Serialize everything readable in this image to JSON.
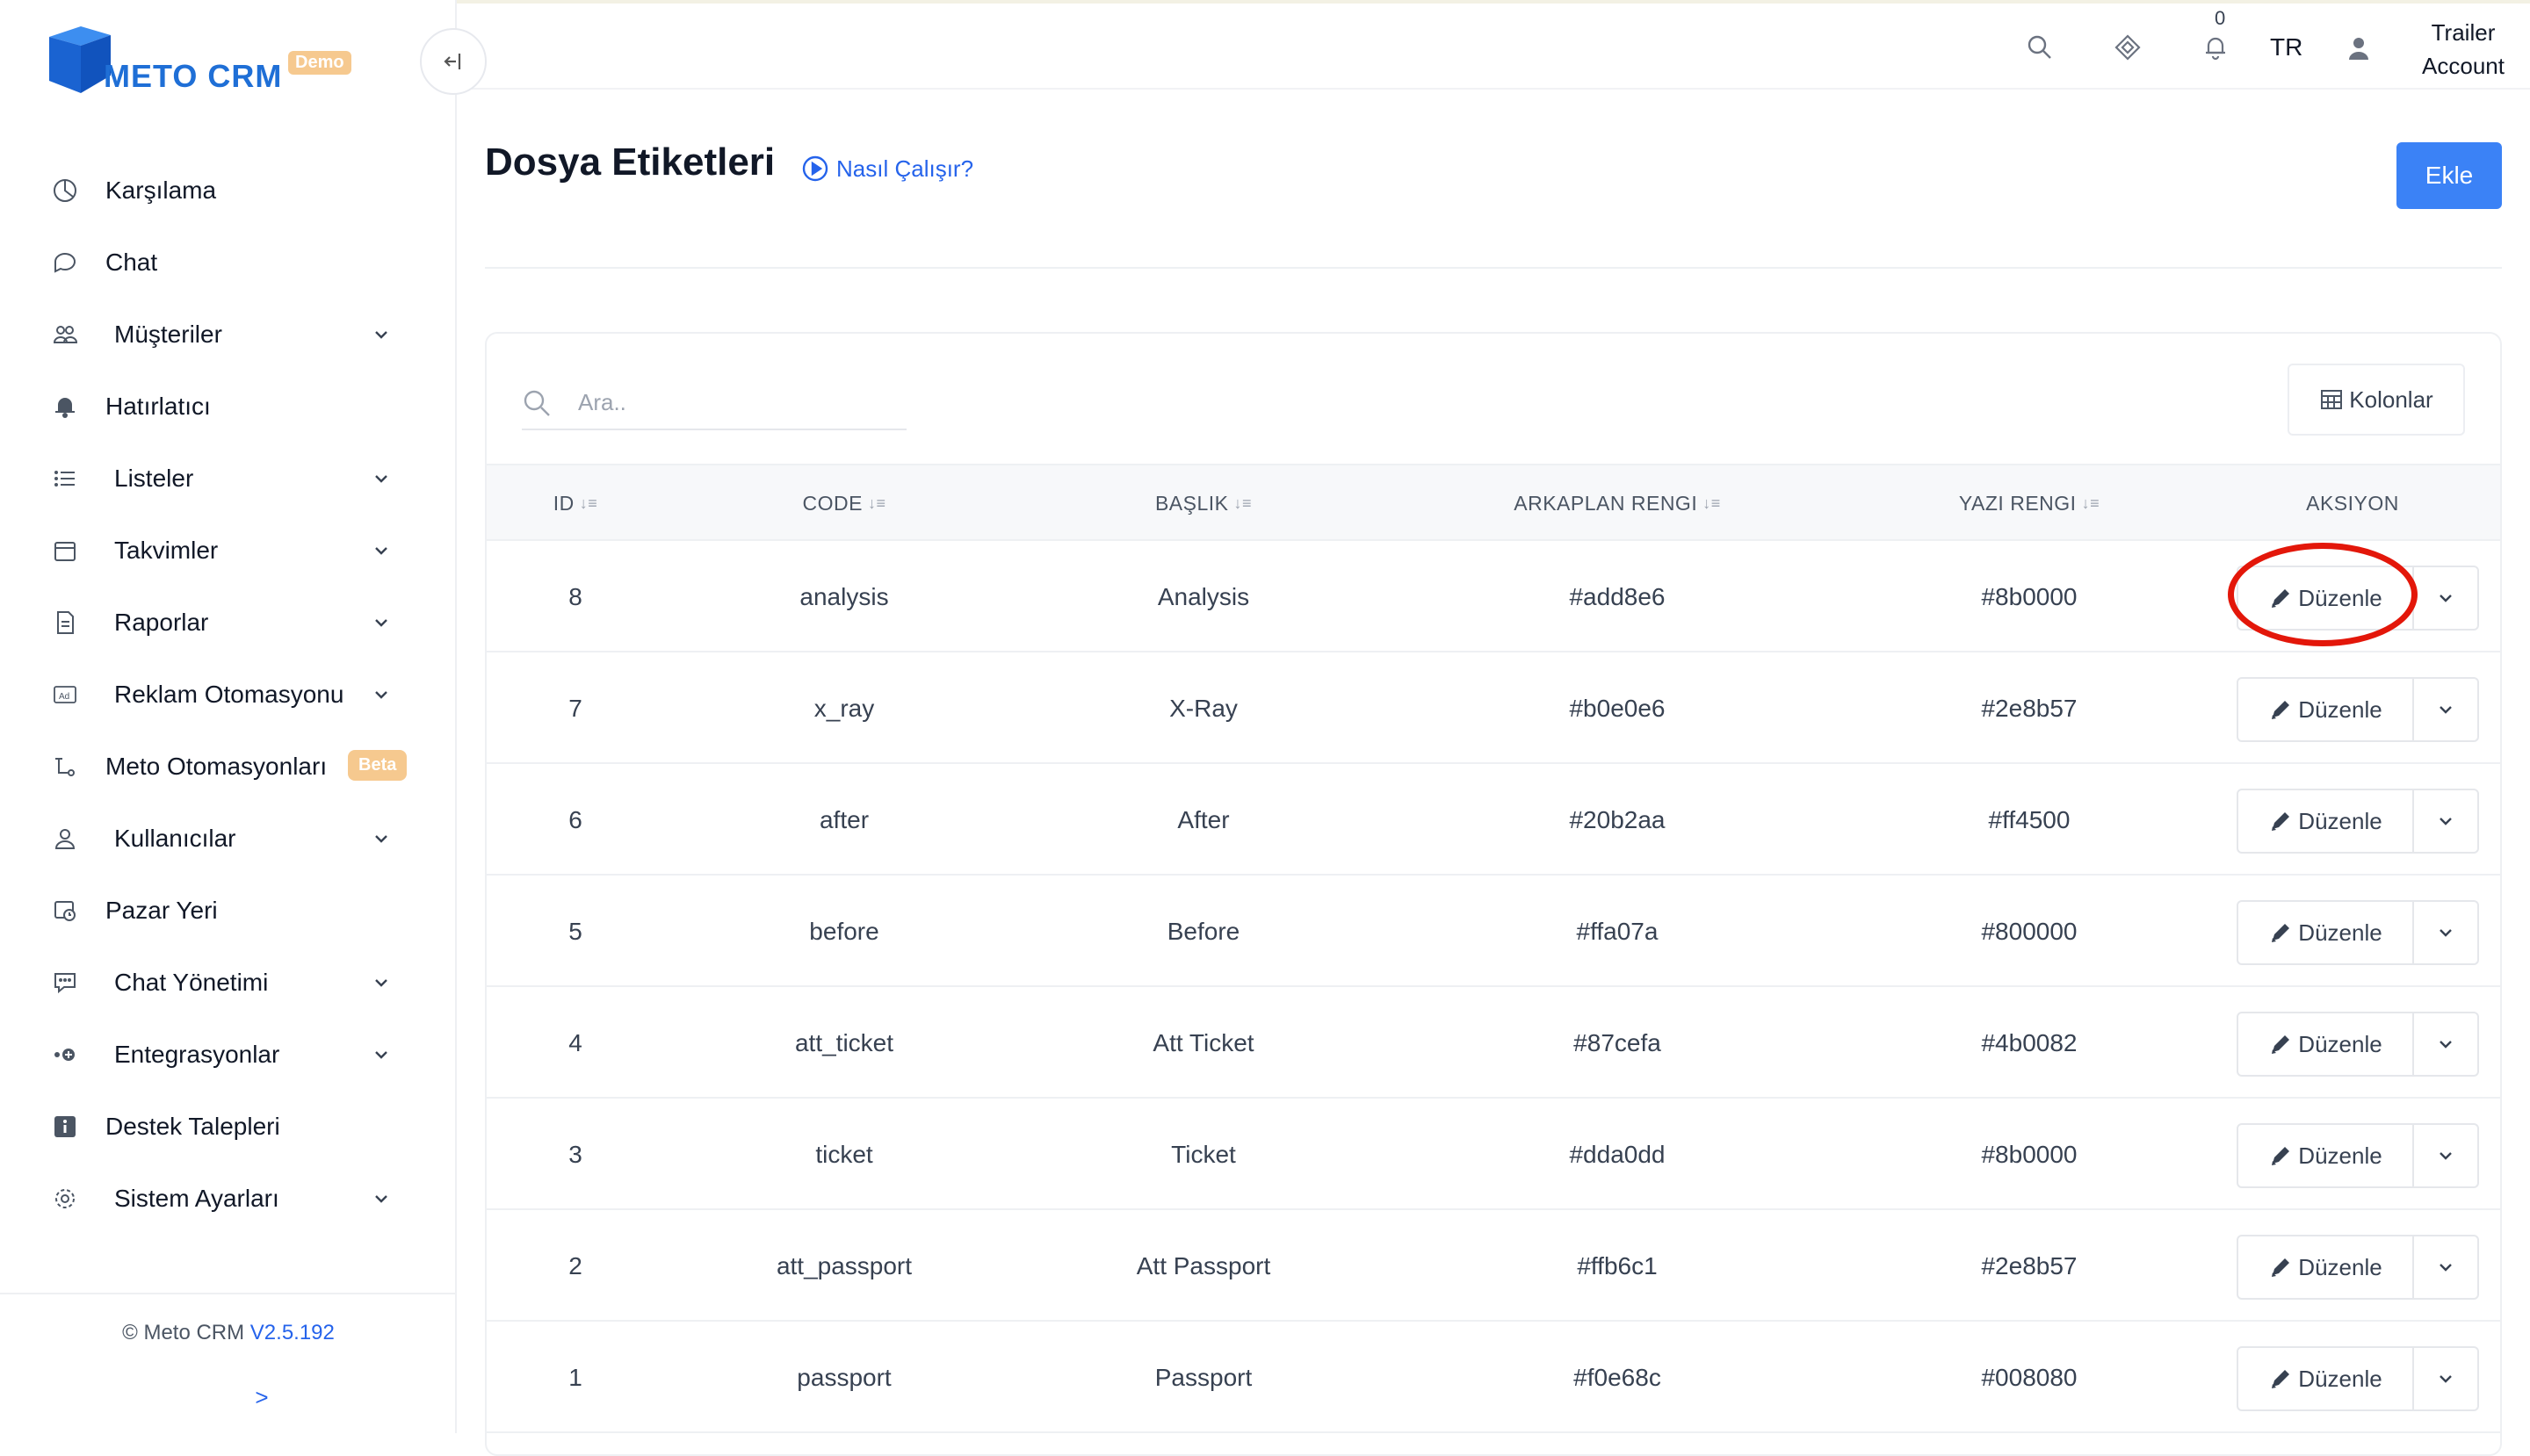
{
  "brand": {
    "name": "METO CRM",
    "badge": "Demo",
    "color": "#1f6fd6"
  },
  "sidebar": {
    "items": [
      {
        "label": "Karşılama",
        "icon": "dashboard-icon",
        "has_submenu": false
      },
      {
        "label": "Chat",
        "icon": "chat-bubble-icon",
        "has_submenu": false
      },
      {
        "label": "Müşteriler",
        "icon": "users-icon",
        "has_submenu": true
      },
      {
        "label": "Hatırlatıcı",
        "icon": "bell-icon",
        "has_submenu": false
      },
      {
        "label": "Listeler",
        "icon": "list-icon",
        "has_submenu": true
      },
      {
        "label": "Takvimler",
        "icon": "calendar-icon",
        "has_submenu": true
      },
      {
        "label": "Raporlar",
        "icon": "report-icon",
        "has_submenu": true
      },
      {
        "label": "Reklam Otomasyonu",
        "icon": "ad-icon",
        "has_submenu": true
      },
      {
        "label": "Meto Otomasyonları",
        "icon": "automation-icon",
        "has_submenu": false,
        "badge": "Beta"
      },
      {
        "label": "Kullanıcılar",
        "icon": "user-icon",
        "has_submenu": true
      },
      {
        "label": "Pazar Yeri",
        "icon": "marketplace-icon",
        "has_submenu": false
      },
      {
        "label": "Chat Yönetimi",
        "icon": "chat-manage-icon",
        "has_submenu": true
      },
      {
        "label": "Entegrasyonlar",
        "icon": "integration-icon",
        "has_submenu": true
      },
      {
        "label": "Destek Talepleri",
        "icon": "info-icon",
        "has_submenu": false
      },
      {
        "label": "Sistem Ayarları",
        "icon": "gear-icon",
        "has_submenu": true
      }
    ],
    "footer": {
      "copyright": "© Meto CRM",
      "version": "V2.5.192",
      "expand": ">"
    }
  },
  "header": {
    "notification_count": "0",
    "language": "TR",
    "account_line1": "Trailer",
    "account_line2": "Account"
  },
  "page": {
    "title": "Dosya Etiketleri",
    "help_link": "Nasıl Çalışır?",
    "add_button": "Ekle"
  },
  "table": {
    "search_placeholder": "Ara..",
    "columns_button": "Kolonlar",
    "headers": [
      "ID",
      "CODE",
      "BAŞLIK",
      "ARKAPLAN RENGI",
      "YAZI RENGI",
      "AKSIYON"
    ],
    "edit_label": "Düzenle",
    "rows": [
      {
        "id": "8",
        "code": "analysis",
        "title": "Analysis",
        "bg": "#add8e6",
        "fg": "#8b0000"
      },
      {
        "id": "7",
        "code": "x_ray",
        "title": "X-Ray",
        "bg": "#b0e0e6",
        "fg": "#2e8b57"
      },
      {
        "id": "6",
        "code": "after",
        "title": "After",
        "bg": "#20b2aa",
        "fg": "#ff4500"
      },
      {
        "id": "5",
        "code": "before",
        "title": "Before",
        "bg": "#ffa07a",
        "fg": "#800000"
      },
      {
        "id": "4",
        "code": "att_ticket",
        "title": "Att Ticket",
        "bg": "#87cefa",
        "fg": "#4b0082"
      },
      {
        "id": "3",
        "code": "ticket",
        "title": "Ticket",
        "bg": "#dda0dd",
        "fg": "#8b0000"
      },
      {
        "id": "2",
        "code": "att_passport",
        "title": "Att Passport",
        "bg": "#ffb6c1",
        "fg": "#2e8b57"
      },
      {
        "id": "1",
        "code": "passport",
        "title": "Passport",
        "bg": "#f0e68c",
        "fg": "#008080"
      }
    ]
  },
  "colors": {
    "accent": "#3b82f6",
    "link": "#2563eb",
    "annotation": "#e3170a"
  }
}
